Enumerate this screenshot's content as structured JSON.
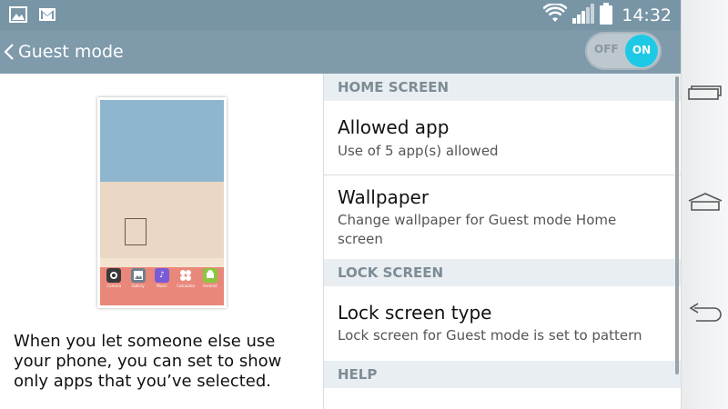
{
  "status_bar": {
    "time": "14:32",
    "icons": [
      "image-notification-icon",
      "gmail-icon",
      "wifi-icon",
      "signal-icon",
      "battery-icon"
    ]
  },
  "action_bar": {
    "title": "Guest mode",
    "toggle": {
      "off_label": "OFF",
      "on_label": "ON",
      "state": "on"
    }
  },
  "left_panel": {
    "preview_apps": [
      {
        "label": "Camera",
        "icon": "camera-icon",
        "color": "#3a3a3a"
      },
      {
        "label": "Gallery",
        "icon": "gallery-icon",
        "color": "#6f7f8c"
      },
      {
        "label": "Music",
        "icon": "music-icon",
        "color": "#7a5bd6"
      },
      {
        "label": "Calculator",
        "icon": "calculator-icon",
        "color": "#e9887a"
      },
      {
        "label": "Android",
        "icon": "android-icon",
        "color": "#8cc63f"
      }
    ],
    "description": "When you let someone else use your phone, you can set to show only apps that you’ve selected."
  },
  "settings": {
    "home_screen_header": "HOME SCREEN",
    "allowed_app": {
      "title": "Allowed app",
      "subtitle": "Use of 5 app(s) allowed"
    },
    "wallpaper": {
      "title": "Wallpaper",
      "subtitle": "Change wallpaper for Guest mode Home screen"
    },
    "lock_screen_header": "LOCK SCREEN",
    "lock_screen_type": {
      "title": "Lock screen type",
      "subtitle": "Lock screen for Guest mode is set to pattern"
    },
    "help_header": "HELP"
  },
  "nav_bar": {
    "buttons": [
      "recent-apps-icon",
      "home-icon",
      "back-icon"
    ]
  },
  "colors": {
    "status_bar": "#7895a6",
    "action_bar": "#7f9aab",
    "toggle_on": "#1ec9e6",
    "section_header_bg": "#e8eef1"
  }
}
